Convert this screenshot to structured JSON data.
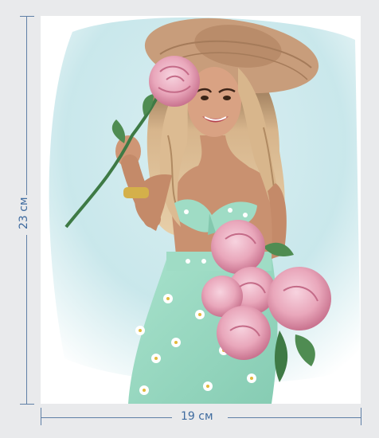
{
  "dimensions": {
    "height_label": "23 см",
    "width_label": "19 см"
  },
  "colors": {
    "page_background": "#e9eaec",
    "sheet": "#ffffff",
    "sky_wash": "#c9e7ec",
    "hat": "#c79c7a",
    "hair": "#cfae86",
    "skin": "#c88f6e",
    "outfit_mint": "#9fdcc5",
    "peony_pink": "#e9a9bd",
    "stem_green": "#3e7a45",
    "dimension_line": "#5f7fa6",
    "dimension_text": "#3f6b9f"
  },
  "illustration": {
    "subject": "woman-with-peonies"
  }
}
